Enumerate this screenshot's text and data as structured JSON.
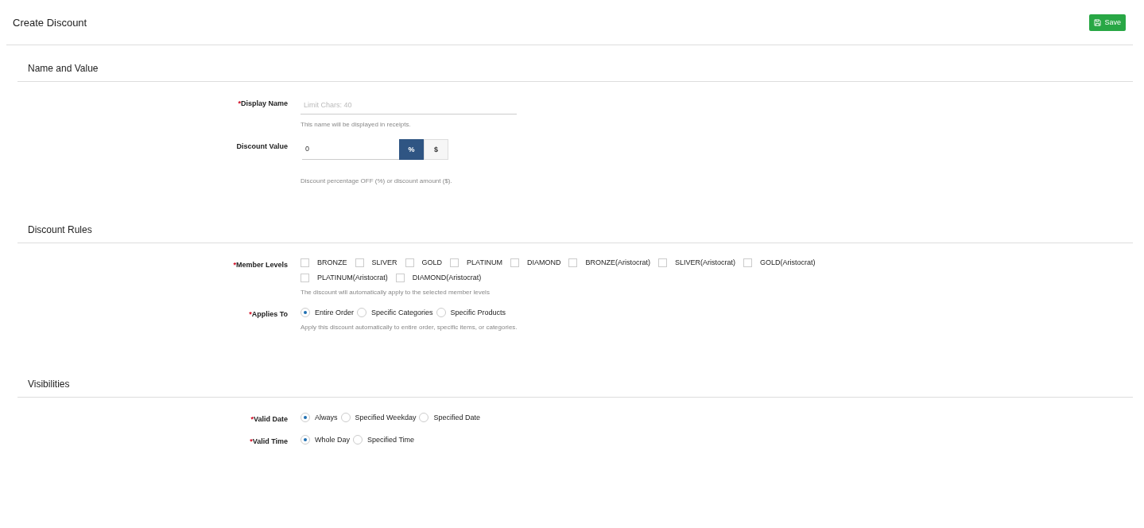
{
  "header": {
    "title": "Create Discount",
    "save_button": "Save"
  },
  "sections": [
    {
      "title": "Name and Value",
      "rows": [
        {
          "kind": "text",
          "marker": "*",
          "label": "Display Name",
          "placeholder": "Limit Chars: 40",
          "help": "This name will be displayed in receipts."
        },
        {
          "kind": "value",
          "label": "Discount Value",
          "value": "0",
          "units": [
            {
              "label": "%",
              "selected": true
            },
            {
              "label": "$",
              "selected": false
            }
          ],
          "help": "Discount percentage OFF (%) or discount amount ($)."
        }
      ]
    },
    {
      "title": "Discount Rules",
      "rows": [
        {
          "kind": "checks",
          "marker": "*",
          "label": "Member Levels",
          "options": [
            {
              "label": "BRONZE",
              "checked": false
            },
            {
              "label": "SLIVER",
              "checked": false
            },
            {
              "label": "GOLD",
              "checked": false
            },
            {
              "label": "PLATINUM",
              "checked": false
            },
            {
              "label": "DIAMOND",
              "checked": false
            },
            {
              "label": "BRONZE(Aristocrat)",
              "checked": false
            },
            {
              "label": "SLIVER(Aristocrat)",
              "checked": false
            },
            {
              "label": "GOLD(Aristocrat)",
              "checked": false
            },
            {
              "label": "PLATINUM(Aristocrat)",
              "checked": false
            },
            {
              "label": "DIAMOND(Aristocrat)",
              "checked": false
            }
          ],
          "help": "The discount will automatically apply to the selected member levels"
        },
        {
          "kind": "radios",
          "marker": "*",
          "label": "Applies To",
          "options": [
            {
              "label": "Entire Order",
              "selected": true
            },
            {
              "label": "Specific Categories",
              "selected": false
            },
            {
              "label": "Specific Products",
              "selected": false
            }
          ],
          "help": "Apply this discount automatically to entire order, specific items, or categories."
        }
      ]
    },
    {
      "title": "Visibilities",
      "rows": [
        {
          "kind": "radios",
          "marker": "*",
          "label": "Valid Date",
          "options": [
            {
              "label": "Always",
              "selected": true
            },
            {
              "label": "Specified Weekday",
              "selected": false
            },
            {
              "label": "Specified Date",
              "selected": false
            }
          ]
        },
        {
          "kind": "radios",
          "marker": "*",
          "label": "Valid Time",
          "options": [
            {
              "label": "Whole Day",
              "selected": true
            },
            {
              "label": "Specified Time",
              "selected": false
            }
          ]
        }
      ]
    }
  ]
}
